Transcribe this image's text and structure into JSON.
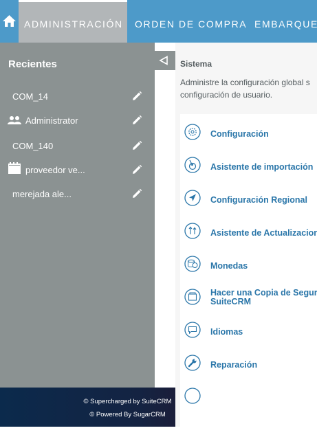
{
  "nav": {
    "tabs": [
      {
        "label": "ADMINISTRACIÓN",
        "active": true
      },
      {
        "label": "ORDEN DE COMPRA"
      },
      {
        "label": "EMBARQUE"
      }
    ],
    "home_icon": "home-icon"
  },
  "sidebar": {
    "title": "Recientes",
    "items": [
      {
        "label": "COM_14",
        "icon": ""
      },
      {
        "label": "Administrator",
        "icon": "users-icon"
      },
      {
        "label": "COM_140",
        "icon": ""
      },
      {
        "label": "proveedor ve...",
        "icon": "calendar-icon"
      },
      {
        "label": "merejada ale...",
        "icon": ""
      }
    ],
    "edit_icon": "pencil-icon"
  },
  "main": {
    "section_title": "Sistema",
    "section_desc": "Administre la configuración global s configuración de usuario.",
    "items": [
      {
        "label": "Configuración",
        "icon": "gear-icon"
      },
      {
        "label": "Asistente de importación",
        "icon": "import-icon"
      },
      {
        "label": "Configuración Regional",
        "icon": "location-arrow-icon"
      },
      {
        "label": "Asistente de Actualizacion",
        "icon": "upgrade-icon"
      },
      {
        "label": "Monedas",
        "icon": "currencies-icon"
      },
      {
        "label": "Hacer una Copia de Segurid SuiteCRM",
        "icon": "backup-icon"
      },
      {
        "label": "Idiomas",
        "icon": "languages-icon"
      },
      {
        "label": "Reparación",
        "icon": "wrench-icon"
      }
    ]
  },
  "footer": {
    "line1": "© Supercharged by SuiteCRM",
    "line2": "© Powered By SugarCRM"
  },
  "colors": {
    "nav_bg": "#4d9ac9",
    "active_tab": "#b2b6b8",
    "sidebar_bg": "#8b9292",
    "link": "#2a76a9",
    "footer_bg": "#0b2a4c"
  }
}
